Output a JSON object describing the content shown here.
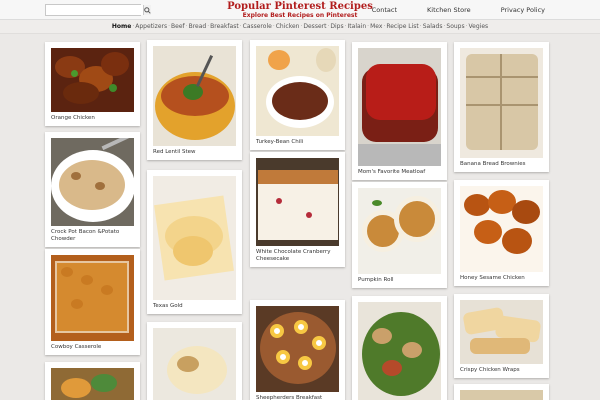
{
  "header": {
    "search_placeholder": "",
    "search_icon": "search-icon",
    "site_title": "Popular Pinterest Recipes",
    "site_subtitle": "Explore Best Recipes on Pinterest",
    "links": [
      "Contact",
      "Kitchen Store",
      "Privacy Policy"
    ]
  },
  "categories": [
    "Home",
    "Appetizers",
    "Beef",
    "Bread",
    "Breakfast",
    "Casserole",
    "Chicken",
    "Dessert",
    "Dips",
    "Italain",
    "Mex",
    "Recipe List",
    "Salads",
    "Soups",
    "Vegies"
  ],
  "active_category": "Home",
  "cards": [
    {
      "caption": "Orange Chicken"
    },
    {
      "caption": "Crock Pot Bacon &Potato Chowder"
    },
    {
      "caption": "Cowboy Casserole"
    },
    {
      "caption": "Red Lentil Stew"
    },
    {
      "caption": "Texas Gold"
    },
    {
      "caption": "Turkey-Bean Chili"
    },
    {
      "caption": "White Chocolate Cranberry Cheesecake"
    },
    {
      "caption": "Sheepherders Breakfast Recipe"
    },
    {
      "caption": "Mom's Favorite Meatloaf"
    },
    {
      "caption": "Pumpkin Roll"
    },
    {
      "caption": "Banana Bread Brownies"
    },
    {
      "caption": "Honey Sesame Chicken"
    },
    {
      "caption": "Crispy Chicken Wraps"
    }
  ],
  "colors": {
    "brand": "#b11c1c",
    "background": "#ebe9e7"
  }
}
